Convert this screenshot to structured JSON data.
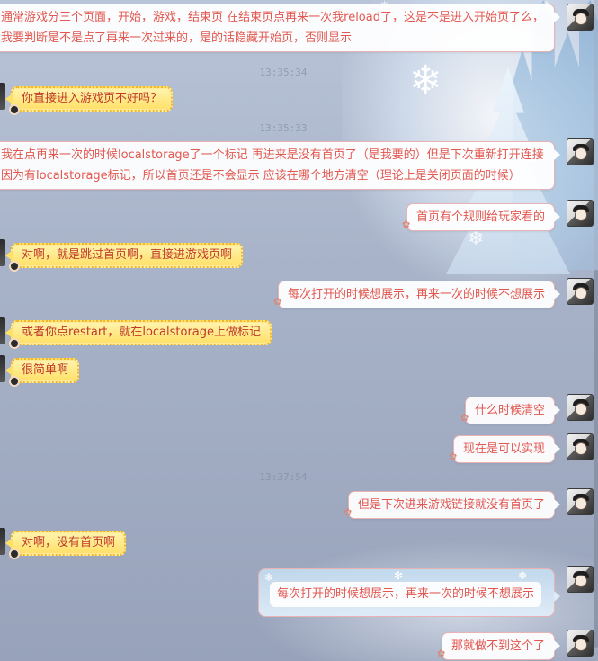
{
  "messages": [
    {
      "side": "right",
      "lines": [
        "通常游戏分三个页面，开始，游戏，结束页   在结束页点再来一次我reload了，这是不是进入开始页了么，",
        "我要判断是不是点了再来一次过来的，是的话隐藏开始页，否则显示"
      ]
    },
    {
      "side": "left",
      "text": "你直接进入游戏页不好吗？"
    },
    {
      "side": "right",
      "lines": [
        "我在点再来一次的时候localstorage了一个标记  再进来是没有首页了（是我要的）但是下次重新打开连接",
        "因为有localstorage标记，所以首页还是不会显示 应该在哪个地方清空（理论上是关闭页面的时候）"
      ]
    },
    {
      "side": "right",
      "text": "首页有个规则给玩家看的"
    },
    {
      "side": "left",
      "text": "对啊，就是跳过首页啊，直接进游戏页啊"
    },
    {
      "side": "right",
      "text": "每次打开的时候想展示，再来一次的时候不想展示"
    },
    {
      "side": "left",
      "text": "或者你点restart，就在localstorage上做标记"
    },
    {
      "side": "left",
      "text": "很简单啊"
    },
    {
      "side": "right",
      "text": "什么时候清空"
    },
    {
      "side": "right",
      "text": "现在是可以实现"
    },
    {
      "side": "right",
      "text": "但是下次进来游戏链接就没有首页了"
    },
    {
      "side": "left",
      "text": "对啊，没有首页啊"
    },
    {
      "side": "right",
      "text": "每次打开的时候想展示，再来一次的时候不想展示",
      "style": "snow"
    },
    {
      "side": "right",
      "text": "那就做不到这个了"
    }
  ],
  "timestamps": [
    "13:35:34",
    "13:35:33",
    "13:37:54"
  ],
  "icons": {
    "avatar": "user-avatar-icon",
    "snowflake": "snowflake-icon",
    "bow": "bow-decoration-icon"
  },
  "colors": {
    "right_text": "#e2574f",
    "left_text": "#c0392b",
    "left_bubble": "#ffe067",
    "right_border": "#e7b3b3"
  }
}
